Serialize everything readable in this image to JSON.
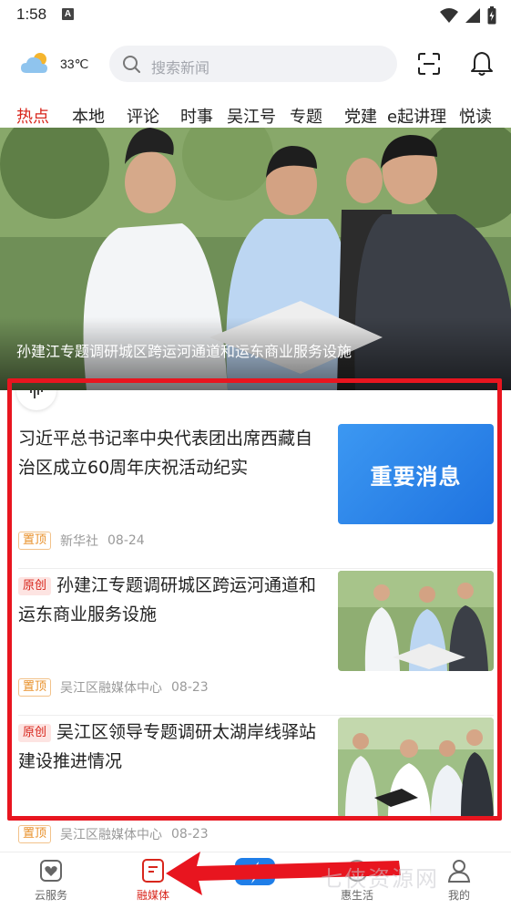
{
  "status_bar": {
    "time": "1:58",
    "notification_icon": "A"
  },
  "header": {
    "temperature": "33℃",
    "search_placeholder": "搜索新闻"
  },
  "tabs": [
    {
      "label": "热点",
      "active": true
    },
    {
      "label": "本地"
    },
    {
      "label": "评论"
    },
    {
      "label": "时事"
    },
    {
      "label": "吴江号"
    },
    {
      "label": "专题"
    },
    {
      "label": "党建"
    },
    {
      "label": "e起讲理"
    },
    {
      "label": "悦读"
    }
  ],
  "hero": {
    "caption": "孙建江专题调研城区跨运河通道和运东商业服务设施"
  },
  "news": [
    {
      "title": "习近平总书记率中央代表团出席西藏自治区成立60周年庆祝活动纪实",
      "thumb_text": "重要消息",
      "top_tag": "置顶",
      "source": "新华社",
      "date": "08-24"
    },
    {
      "tag": "原创",
      "title": "孙建江专题调研城区跨运河通道和运东商业服务设施",
      "top_tag": "置顶",
      "source": "吴江区融媒体中心",
      "date": "08-23"
    },
    {
      "tag": "原创",
      "title": "吴江区领导专题调研太湖岸线驿站建设推进情况",
      "top_tag": "置顶",
      "source": "吴江区融媒体中心",
      "date": "08-23"
    }
  ],
  "bottom_nav": [
    {
      "label": "云服务",
      "icon": "heart-shield-icon"
    },
    {
      "label": "融媒体",
      "icon": "media-icon",
      "active": true
    },
    {
      "label": "",
      "icon": "lightning-logo-icon"
    },
    {
      "label": "惠生活",
      "icon": "life-icon"
    },
    {
      "label": "我的",
      "icon": "person-icon"
    }
  ],
  "watermark": "七侠资源网",
  "colors": {
    "accent": "#d8261c",
    "highlight": "#e8151f",
    "thumb_blue": "#1f7ee8"
  }
}
